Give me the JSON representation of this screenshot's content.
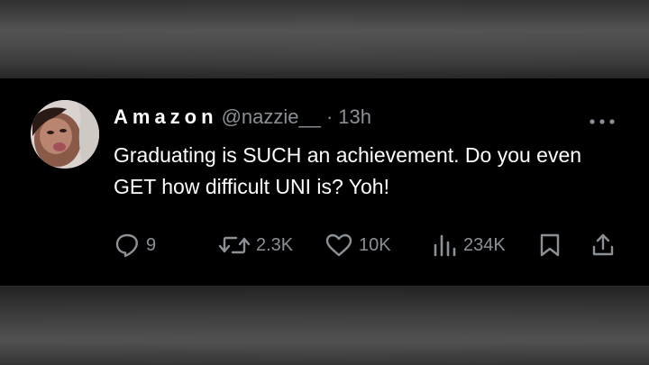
{
  "tweet": {
    "display_name": "Amazon",
    "handle": "@nazzie__",
    "separator": "·",
    "time": "13h",
    "text": "Graduating is SUCH an achievement. Do you even GET how difficult UNI is? Yoh!",
    "avatar_icon": "profile-photo",
    "more_icon": "more-dots-icon"
  },
  "metrics": {
    "replies": "9",
    "reposts": "2.3K",
    "likes": "10K",
    "views": "234K"
  },
  "colors": {
    "card_background": "#000000",
    "primary_text": "#ffffff",
    "secondary_text": "#8b9096"
  }
}
